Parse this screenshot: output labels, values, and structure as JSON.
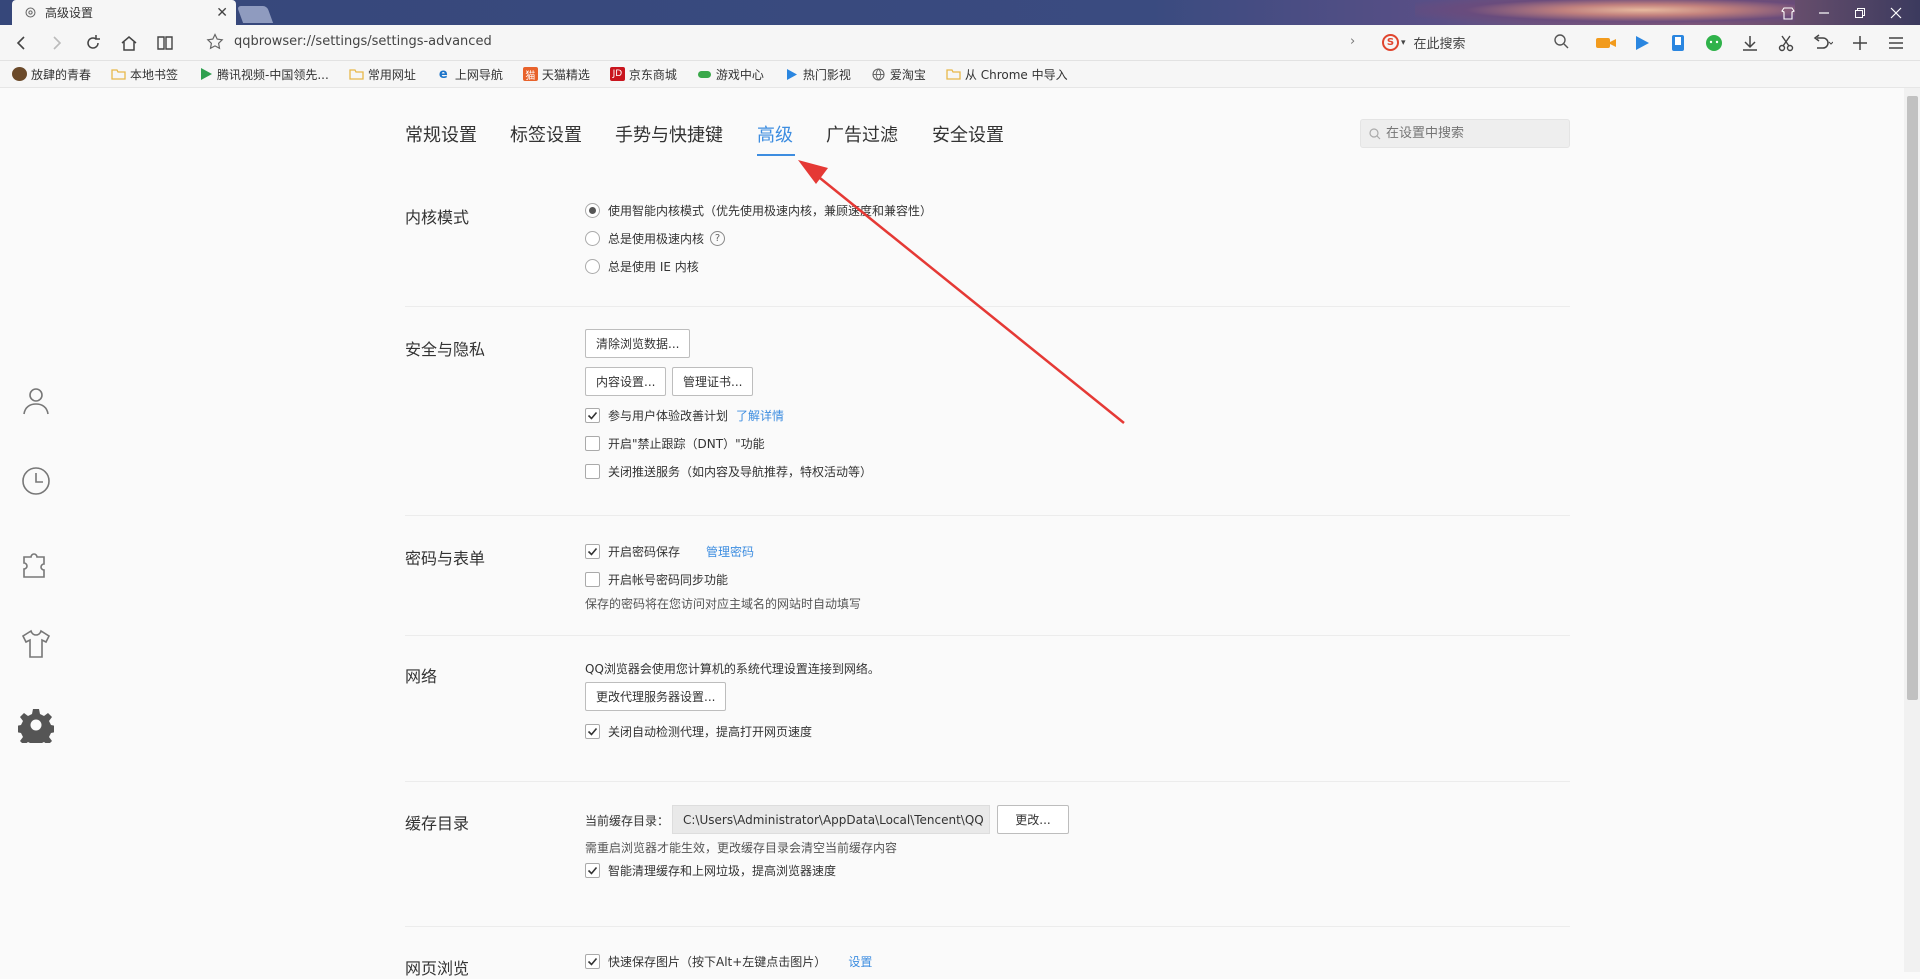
{
  "window": {
    "tab_title": "高级设置",
    "tab_icon": "gear-icon",
    "hero_image": "game-character-banner"
  },
  "address": {
    "url": "qqbrowser://settings/settings-advanced",
    "search_placeholder": "在此搜索",
    "search_engine_logo": "S"
  },
  "bookmarks": [
    {
      "label": "放肆的青春",
      "icon": "avatar-icon",
      "color": "#6b4a2a"
    },
    {
      "label": "本地书签",
      "icon": "folder-icon",
      "color": "#e8b84a"
    },
    {
      "label": "腾讯视频-中国领先...",
      "icon": "tencent-video-icon",
      "color": "#2fa04f"
    },
    {
      "label": "常用网址",
      "icon": "folder-icon",
      "color": "#e8b84a"
    },
    {
      "label": "上网导航",
      "icon": "ie-nav-icon",
      "color": "#1a73c9"
    },
    {
      "label": "天猫精选",
      "icon": "tmall-icon",
      "color": "#e8622b"
    },
    {
      "label": "京东商城",
      "icon": "jd-icon",
      "color": "#c9151e"
    },
    {
      "label": "游戏中心",
      "icon": "gamepad-icon",
      "color": "#3aa84a"
    },
    {
      "label": "热门影视",
      "icon": "play-icon",
      "color": "#2a86e0"
    },
    {
      "label": "爱淘宝",
      "icon": "globe-icon",
      "color": "#666666"
    },
    {
      "label": "从 Chrome 中导入",
      "icon": "folder-icon",
      "color": "#e8b84a"
    }
  ],
  "settings_tabs": [
    {
      "label": "常规设置",
      "active": false
    },
    {
      "label": "标签设置",
      "active": false
    },
    {
      "label": "手势与快捷键",
      "active": false
    },
    {
      "label": "高级",
      "active": true
    },
    {
      "label": "广告过滤",
      "active": false
    },
    {
      "label": "安全设置",
      "active": false
    }
  ],
  "settings_search_placeholder": "在设置中搜索",
  "kernel": {
    "title": "内核模式",
    "options": [
      {
        "label": "使用智能内核模式（优先使用极速内核，兼顾速度和兼容性）",
        "selected": true
      },
      {
        "label": "总是使用极速内核",
        "selected": false,
        "help": "?"
      },
      {
        "label": "总是使用 IE 内核",
        "selected": false
      }
    ]
  },
  "privacy": {
    "title": "安全与隐私",
    "clear_btn": "清除浏览数据...",
    "content_btn": "内容设置...",
    "cert_btn": "管理证书...",
    "checks": [
      {
        "label": "参与用户体验改善计划",
        "checked": true,
        "link": "了解详情"
      },
      {
        "label": "开启\"禁止跟踪（DNT）\"功能",
        "checked": false
      },
      {
        "label": "关闭推送服务（如内容及导航推荐，特权活动等）",
        "checked": false
      }
    ]
  },
  "passwords": {
    "title": "密码与表单",
    "checks": [
      {
        "label": "开启密码保存",
        "checked": true,
        "link": "管理密码"
      },
      {
        "label": "开启帐号密码同步功能",
        "checked": false
      }
    ],
    "note": "保存的密码将在您访问对应主域名的网站时自动填写"
  },
  "network": {
    "title": "网络",
    "note": "QQ浏览器会使用您计算机的系统代理设置连接到网络。",
    "proxy_btn": "更改代理服务器设置...",
    "check": {
      "label": "关闭自动检测代理，提高打开网页速度",
      "checked": true
    }
  },
  "cache": {
    "title": "缓存目录",
    "path_label": "当前缓存目录：",
    "path": "C:\\Users\\Administrator\\AppData\\Local\\Tencent\\QQ",
    "change_btn": "更改...",
    "note": "需重启浏览器才能生效，更改缓存目录会清空当前缓存内容",
    "check": {
      "label": "智能清理缓存和上网垃圾，提高浏览器速度",
      "checked": true
    }
  },
  "browsing": {
    "title": "网页浏览",
    "check": {
      "label": "快速保存图片（按下Alt+左键点击图片）",
      "checked": true,
      "link": "设置"
    }
  },
  "annotation": {
    "color": "#e53935"
  }
}
